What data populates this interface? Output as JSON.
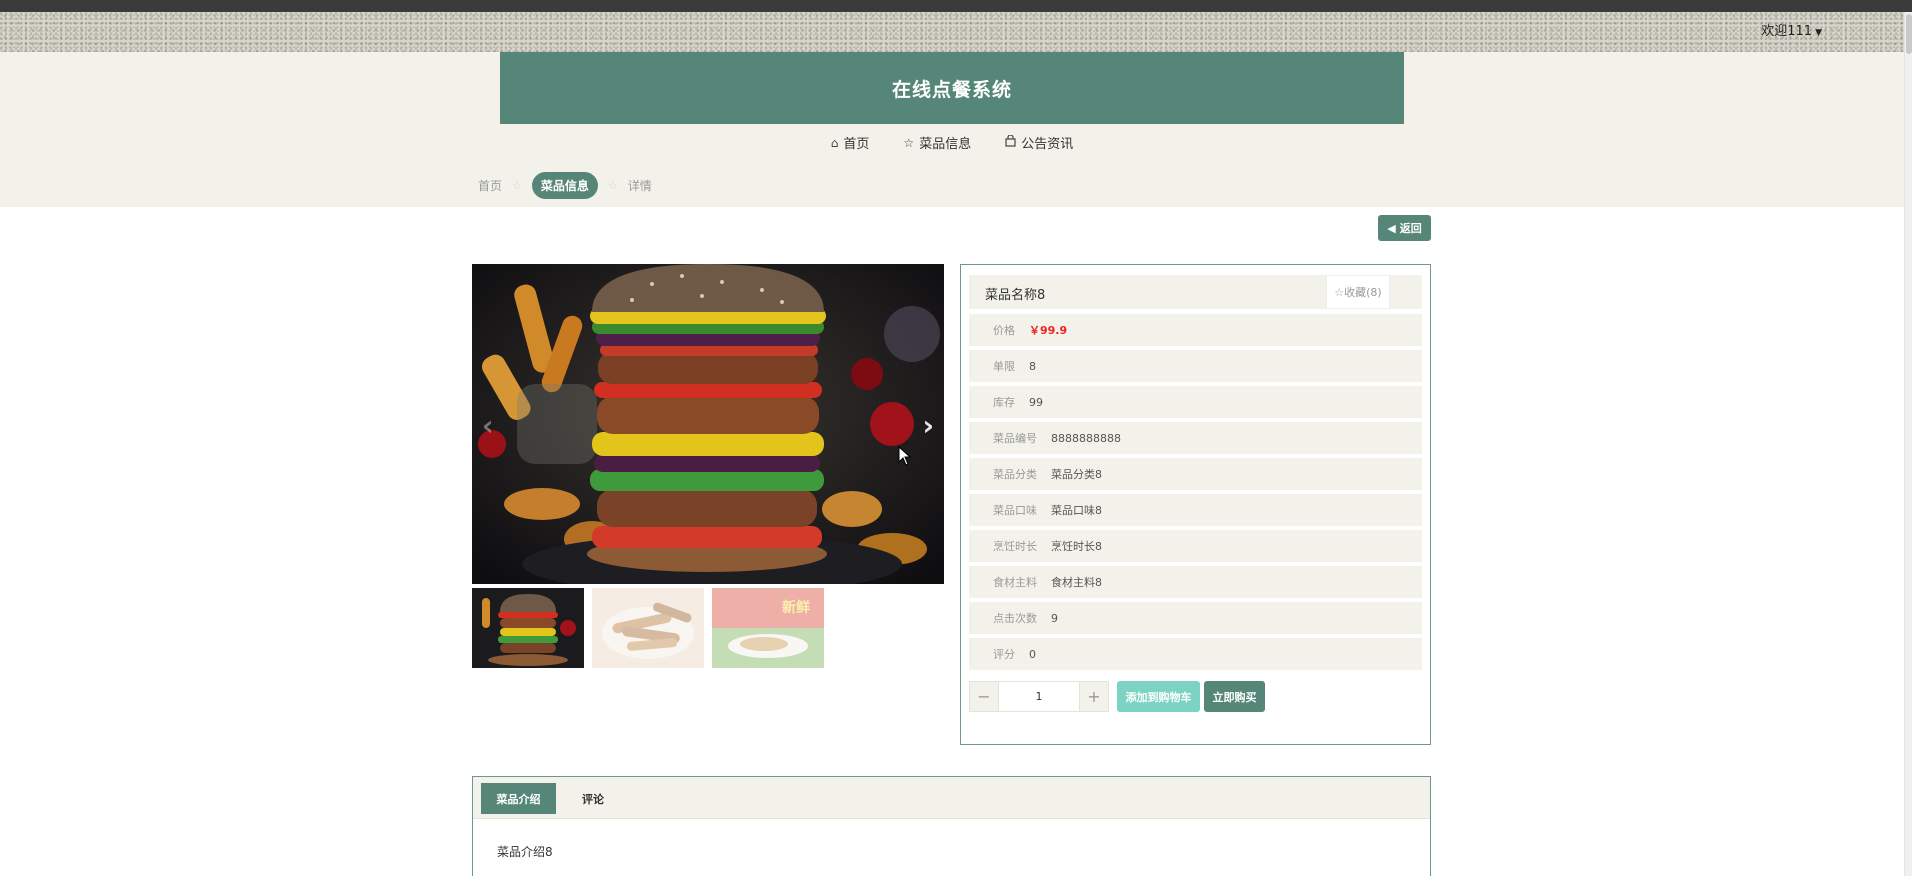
{
  "header": {
    "welcome": "欢迎111",
    "site_title": "在线点餐系统"
  },
  "nav": {
    "items": [
      {
        "label": "首页",
        "icon": "home-icon"
      },
      {
        "label": "菜品信息",
        "icon": "star-icon"
      },
      {
        "label": "公告资讯",
        "icon": "bag-icon"
      }
    ]
  },
  "breadcrumb": {
    "items": [
      "首页",
      "菜品信息",
      "详情"
    ],
    "active_index": 1
  },
  "back_button": "返回",
  "product": {
    "name": "菜品名称8",
    "favorite": "☆收藏(8)",
    "fields": [
      {
        "label": "价格",
        "value": "￥99.9"
      },
      {
        "label": "单限",
        "value": "8"
      },
      {
        "label": "库存",
        "value": "99"
      },
      {
        "label": "菜品编号",
        "value": "8888888888"
      },
      {
        "label": "菜品分类",
        "value": "菜品分类8"
      },
      {
        "label": "菜品口味",
        "value": "菜品口味8"
      },
      {
        "label": "烹饪时长",
        "value": "烹饪时长8"
      },
      {
        "label": "食材主料",
        "value": "食材主料8"
      },
      {
        "label": "点击次数",
        "value": "9"
      },
      {
        "label": "评分",
        "value": "0"
      }
    ],
    "quantity": "1",
    "add_to_cart": "添加到购物车",
    "buy_now": "立即购买"
  },
  "tabs": {
    "items": [
      "菜品介绍",
      "评论"
    ],
    "content": "菜品介绍8"
  },
  "thumbnail_3_text": "新鲜"
}
